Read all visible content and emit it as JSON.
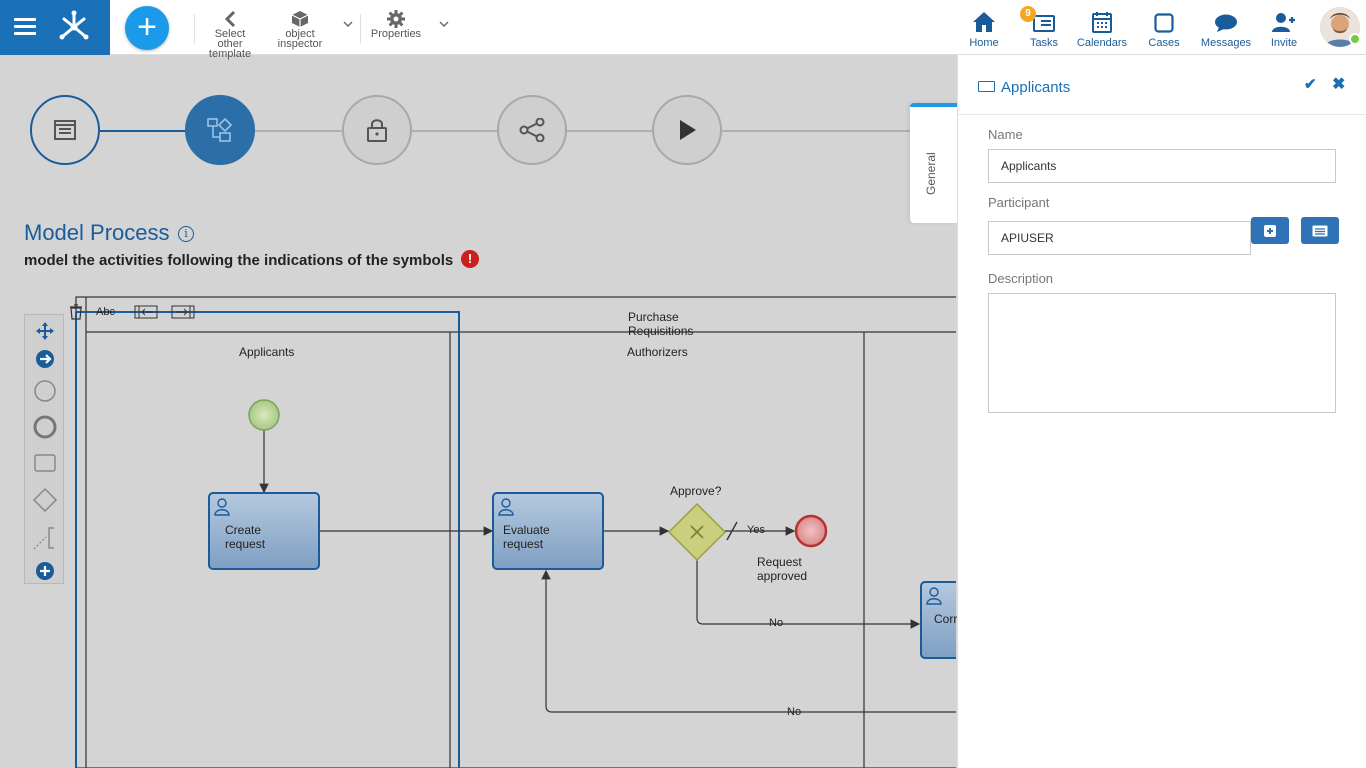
{
  "toolbar": {
    "select_template_label": "Select other template",
    "object_inspector_label": "object inspector",
    "properties_label": "Properties"
  },
  "nav": {
    "home": "Home",
    "tasks": "Tasks",
    "tasks_badge": "9",
    "calendars": "Calendars",
    "cases": "Cases",
    "messages": "Messages",
    "invite": "Invite"
  },
  "steps": {
    "icons": [
      "form-icon",
      "process-model-icon",
      "lock-icon",
      "share-icon",
      "play-icon"
    ]
  },
  "page": {
    "title": "Model Process",
    "subtitle": "model the activities following the indications of the symbols"
  },
  "diagram": {
    "pool_name": "Purchase Requisitions",
    "pool_toolbar_text": "Abc",
    "lanes": [
      "Applicants",
      "Authorizers"
    ],
    "tasks": {
      "create": "Create request",
      "evaluate": "Evaluate request",
      "partial": "Corr"
    },
    "gateway_label": "Approve?",
    "yes_label": "Yes",
    "no_label_1": "No",
    "no_label_2": "No",
    "end_label": "Request approved"
  },
  "panel": {
    "tab_label": "General",
    "title": "Applicants",
    "name_label": "Name",
    "name_value": "Applicants",
    "participant_label": "Participant",
    "participant_value": "APIUSER",
    "description_label": "Description",
    "description_value": ""
  },
  "colors": {
    "brand": "#1a71b8",
    "accent": "#1a9ae8",
    "primary_text": "#1a5c9a"
  }
}
